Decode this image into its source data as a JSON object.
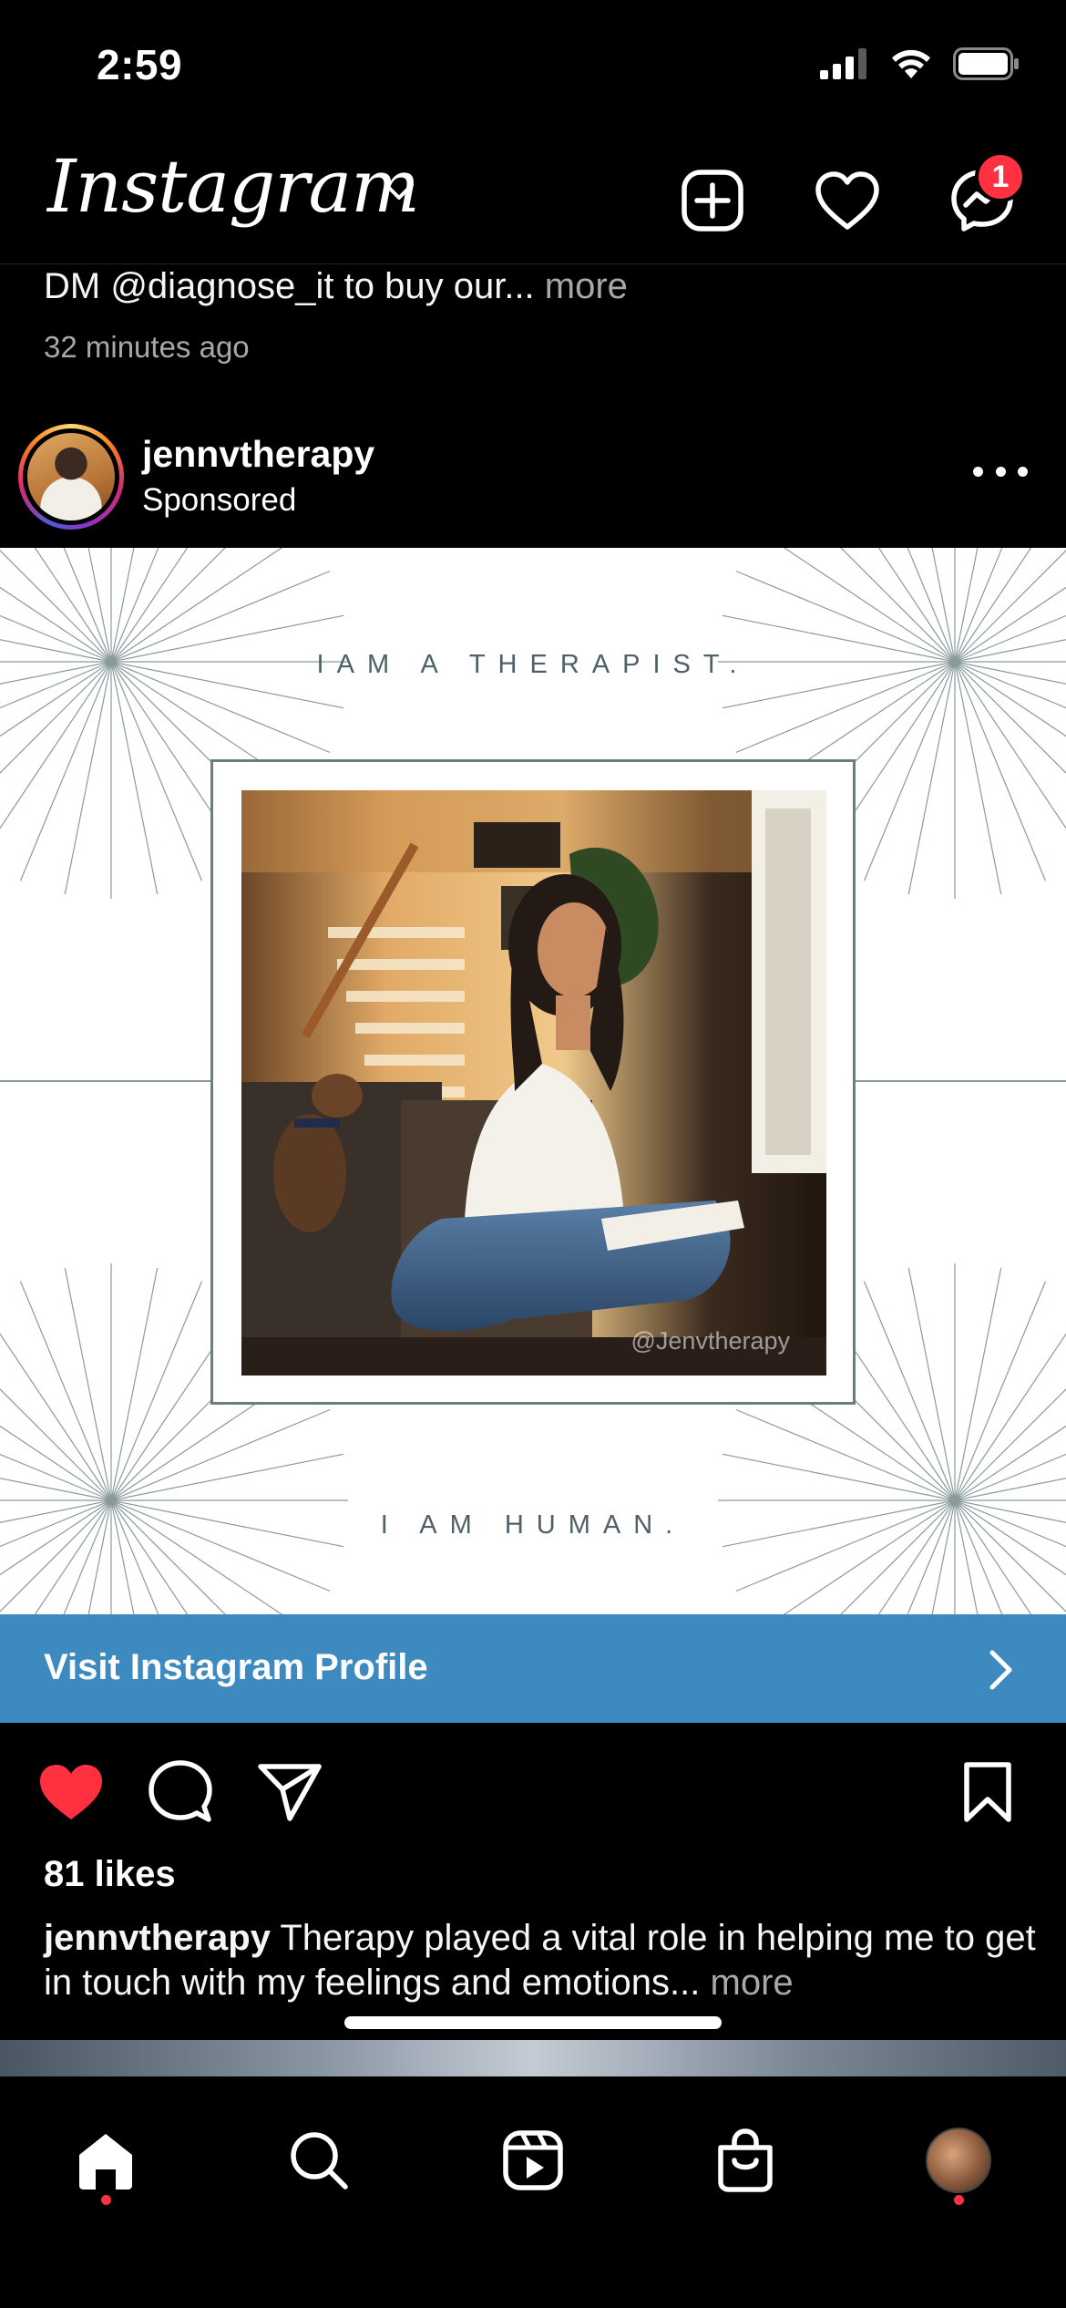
{
  "status_bar": {
    "time": "2:59"
  },
  "header": {
    "logo": "Instagram",
    "notification_badge": "1"
  },
  "previous_post": {
    "caption": "DM @diagnose_it to buy our...",
    "more": "more",
    "timestamp": "32 minutes ago"
  },
  "post": {
    "username": "jennvtherapy",
    "label": "Sponsored",
    "image": {
      "tagline_top": "IAM A THERAPIST.",
      "tagline_bottom": "I AM HUMAN.",
      "watermark": "@Jenvtherapy"
    },
    "cta_label": "Visit Instagram Profile",
    "likes": "81 likes",
    "caption_user": "jennvtherapy",
    "caption_text": "Therapy played a vital role in helping me to get in touch with my feelings and emotions...",
    "caption_more": "more",
    "liked": true
  },
  "colors": {
    "background": "#000000",
    "cta_blue": "#3d8ac1",
    "like_red": "#ff3040",
    "muted_text": "#a8a8a8",
    "image_accent": "#4d6166"
  },
  "icons": {
    "header": [
      "chevron-down-icon",
      "new-post-icon",
      "heart-icon",
      "messenger-icon"
    ],
    "actions": [
      "heart-filled-icon",
      "comment-icon",
      "share-icon",
      "bookmark-icon"
    ],
    "nav": [
      "home-icon",
      "search-icon",
      "reels-icon",
      "shop-icon",
      "profile-avatar"
    ]
  }
}
